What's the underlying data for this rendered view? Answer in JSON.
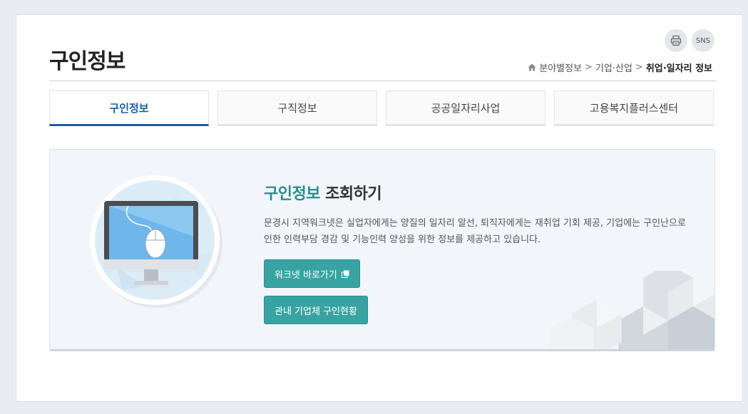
{
  "page": {
    "title": "구인정보"
  },
  "utilities": {
    "print_icon": "printer-icon",
    "sns_label": "SNS"
  },
  "breadcrumb": {
    "home_icon": "home-icon",
    "items": [
      "분야별정보",
      "기업·산업",
      "취업·일자리 정보"
    ]
  },
  "tabs": [
    {
      "label": "구인정보",
      "active": true
    },
    {
      "label": "구직정보",
      "active": false
    },
    {
      "label": "공공일자리사업",
      "active": false
    },
    {
      "label": "고용복지플러스센터",
      "active": false
    }
  ],
  "info": {
    "heading_accent": "구인정보",
    "heading_rest": "조회하기",
    "description": "문경시 지역워크넷은 실업자에게는 양질의 일자리 알선, 퇴직자에게는 재취업 기회 제공, 기업에는 구인난으로 인한 인력부담 경감 및 기능인력 양성을 위한 정보를 제공하고 있습니다.",
    "buttons": [
      {
        "label": "워크넷 바로가기",
        "icon": "external-window-icon"
      },
      {
        "label": "관내 기업체 구인현황"
      }
    ]
  },
  "colors": {
    "accent": "#1a5fa8",
    "teal": "#39a3a3",
    "heading_accent": "#2a8c91"
  }
}
